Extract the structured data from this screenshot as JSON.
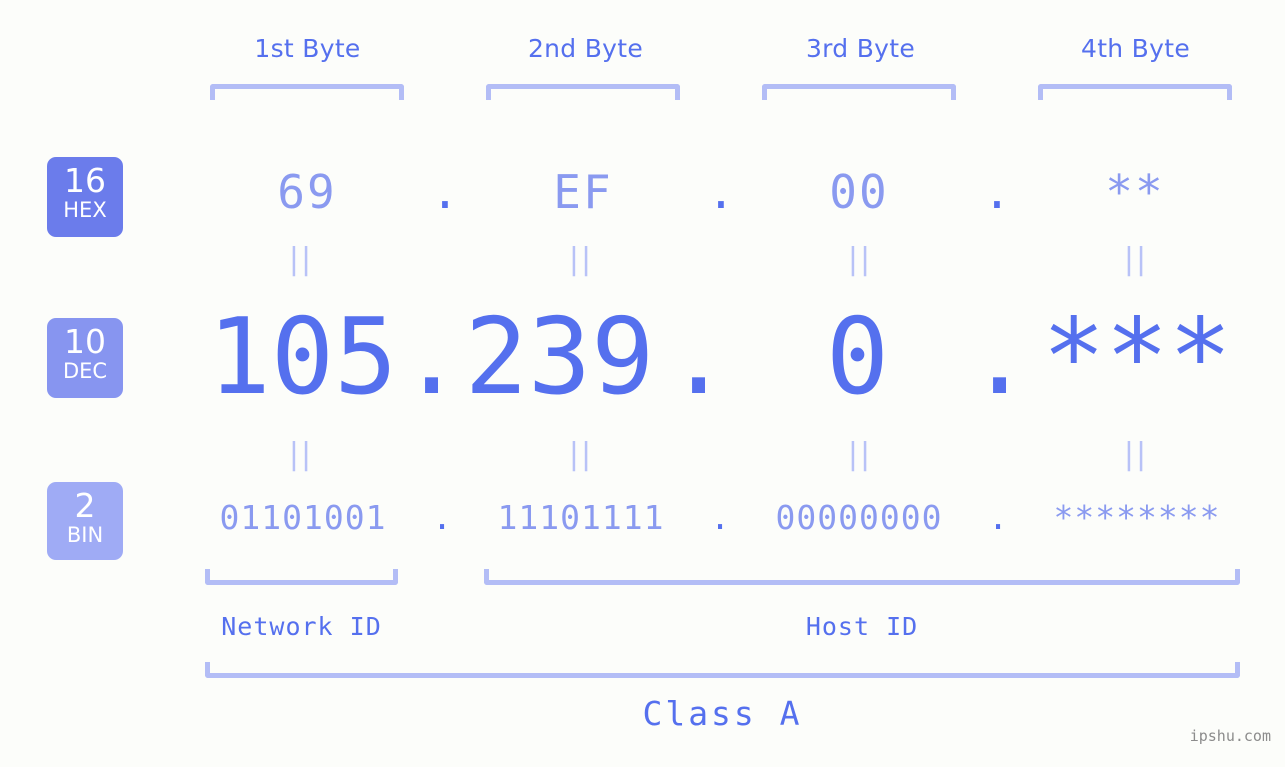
{
  "meta": {
    "watermark": "ipshu.com",
    "background_color": "#fcfdfa",
    "accent_strong": "#5570ee",
    "accent_light": "#8a9af0",
    "bracket_color": "#b3bdf6"
  },
  "headers": [
    {
      "label": "1st Byte"
    },
    {
      "label": "2nd Byte"
    },
    {
      "label": "3rd Byte"
    },
    {
      "label": "4th Byte"
    }
  ],
  "bases": [
    {
      "number": "16",
      "name": "HEX",
      "color": "#6b7ceb"
    },
    {
      "number": "10",
      "name": "DEC",
      "color": "#8795f0"
    },
    {
      "number": "2",
      "name": "BIN",
      "color": "#9fabf5"
    }
  ],
  "rows": {
    "hex": {
      "base_number": "16",
      "base_name": "HEX",
      "values": [
        "69",
        "EF",
        "00",
        "**"
      ],
      "separators": [
        ".",
        ".",
        "."
      ]
    },
    "dec": {
      "base_number": "10",
      "base_name": "DEC",
      "values": [
        "105",
        "239",
        "0",
        "***"
      ],
      "separators": [
        ".",
        ".",
        "."
      ]
    },
    "bin": {
      "base_number": "2",
      "base_name": "BIN",
      "values": [
        "01101001",
        "11101111",
        "00000000",
        "********"
      ],
      "separators": [
        ".",
        ".",
        "."
      ]
    }
  },
  "equals_connectors": {
    "symbol": "||",
    "count_upper": 4,
    "count_lower": 4
  },
  "id_sections": [
    {
      "label": "Network ID"
    },
    {
      "label": "Host ID"
    }
  ],
  "class_section": {
    "label": "Class A"
  }
}
